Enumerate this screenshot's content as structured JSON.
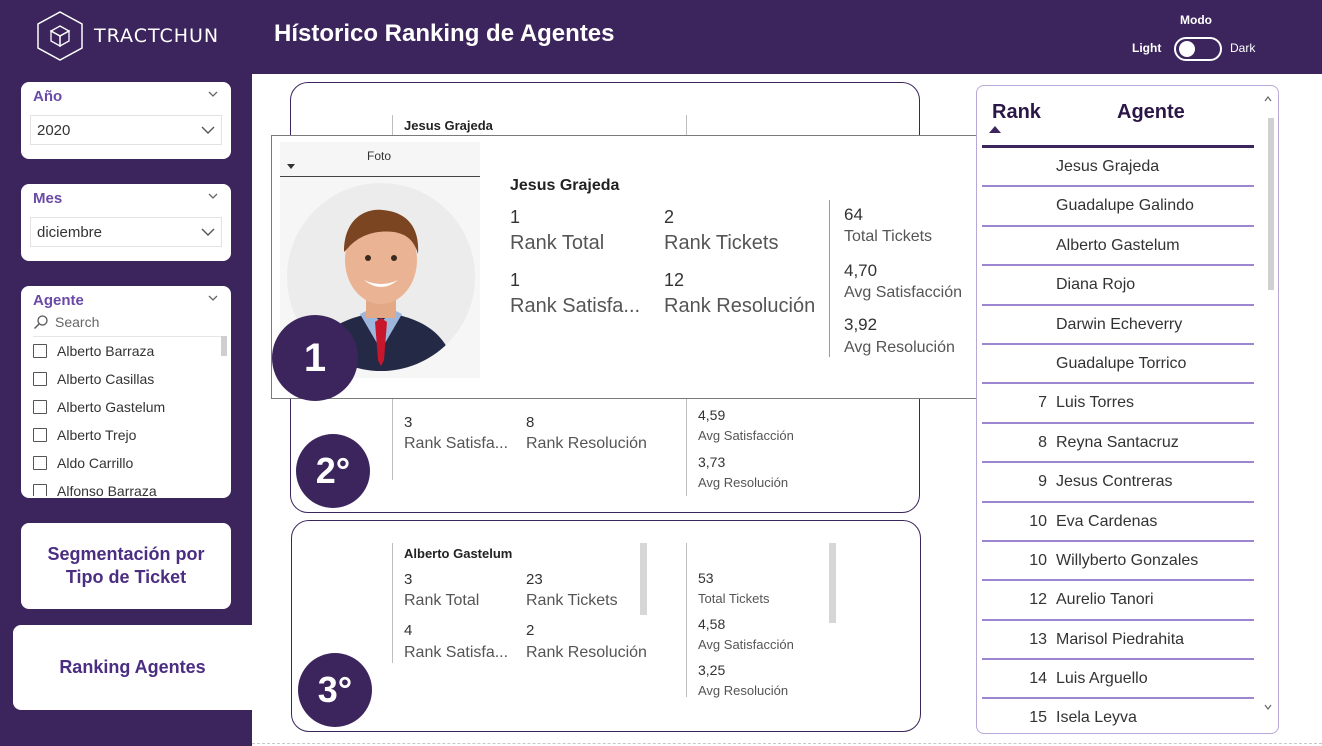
{
  "brand": {
    "logo_text": "TRACTCHUN"
  },
  "header": {
    "title": "Hístorico Ranking de Agentes",
    "mode_label": "Modo",
    "light_label": "Light",
    "dark_label": "Dark"
  },
  "slicers": {
    "anio": {
      "title": "Año",
      "value": "2020"
    },
    "mes": {
      "title": "Mes",
      "value": "diciembre"
    },
    "agente": {
      "title": "Agente",
      "search_placeholder": "Search",
      "options": [
        "Alberto Barraza",
        "Alberto Casillas",
        "Alberto Gastelum",
        "Alberto Trejo",
        "Aldo Carrillo",
        "Alfonso Barraza"
      ]
    }
  },
  "nav": {
    "segmentacion": "Segmentación por Tipo de Ticket",
    "ranking": "Ranking Agentes"
  },
  "cards": [
    {
      "badge": "1",
      "name": "Jesus Grajeda"
    },
    {
      "badge": "2°",
      "rank_satisfaccion": "3",
      "rank_satisfaccion_label": "Rank Satisfa...",
      "rank_resolucion": "8",
      "rank_resolucion_label": "Rank Resolución",
      "avg_satisfaccion": "4,59",
      "avg_satisfaccion_label": "Avg Satisfacción",
      "avg_resolucion": "3,73",
      "avg_resolucion_label": "Avg Resolución"
    },
    {
      "badge": "3°",
      "name": "Alberto Gastelum",
      "rank_total": "3",
      "rank_total_label": "Rank Total",
      "rank_tickets": "23",
      "rank_tickets_label": "Rank Tickets",
      "rank_satisfaccion": "4",
      "rank_satisfaccion_label": "Rank Satisfa...",
      "rank_resolucion": "2",
      "rank_resolucion_label": "Rank Resolución",
      "total_tickets": "53",
      "total_tickets_label": "Total Tickets",
      "avg_satisfaccion": "4,58",
      "avg_satisfaccion_label": "Avg Satisfacción",
      "avg_resolucion": "3,25",
      "avg_resolucion_label": "Avg Resolución"
    }
  ],
  "tooltip": {
    "foto_label": "Foto",
    "badge": "1",
    "name": "Jesus Grajeda",
    "rank_total": "1",
    "rank_total_label": "Rank Total",
    "rank_tickets": "2",
    "rank_tickets_label": "Rank Tickets",
    "rank_satisfaccion": "1",
    "rank_satisfaccion_label": "Rank Satisfa...",
    "rank_resolucion": "12",
    "rank_resolucion_label": "Rank Resolución",
    "total_tickets": "64",
    "total_tickets_label": "Total Tickets",
    "avg_satisfaccion": "4,70",
    "avg_satisfaccion_label": "Avg Satisfacción",
    "avg_resolucion": "3,92",
    "avg_resolucion_label": "Avg Resolución"
  },
  "rank_table": {
    "header_rank": "Rank",
    "header_agent": "Agente",
    "rows": [
      {
        "rank": "",
        "agent": "Jesus Grajeda"
      },
      {
        "rank": "",
        "agent": "Guadalupe Galindo"
      },
      {
        "rank": "",
        "agent": "Alberto Gastelum"
      },
      {
        "rank": "",
        "agent": "Diana Rojo"
      },
      {
        "rank": "",
        "agent": "Darwin Echeverry"
      },
      {
        "rank": "",
        "agent": "Guadalupe Torrico"
      },
      {
        "rank": "7",
        "agent": "Luis Torres"
      },
      {
        "rank": "8",
        "agent": "Reyna Santacruz"
      },
      {
        "rank": "9",
        "agent": "Jesus Contreras"
      },
      {
        "rank": "10",
        "agent": "Eva Cardenas"
      },
      {
        "rank": "10",
        "agent": "Willyberto Gonzales"
      },
      {
        "rank": "12",
        "agent": "Aurelio Tanori"
      },
      {
        "rank": "13",
        "agent": "Marisol Piedrahita"
      },
      {
        "rank": "14",
        "agent": "Luis Arguello"
      },
      {
        "rank": "15",
        "agent": "Isela Leyva"
      }
    ]
  },
  "colors": {
    "primary": "#3c255c",
    "accent": "#6a4aa6",
    "row_divider": "#9b86cf"
  }
}
